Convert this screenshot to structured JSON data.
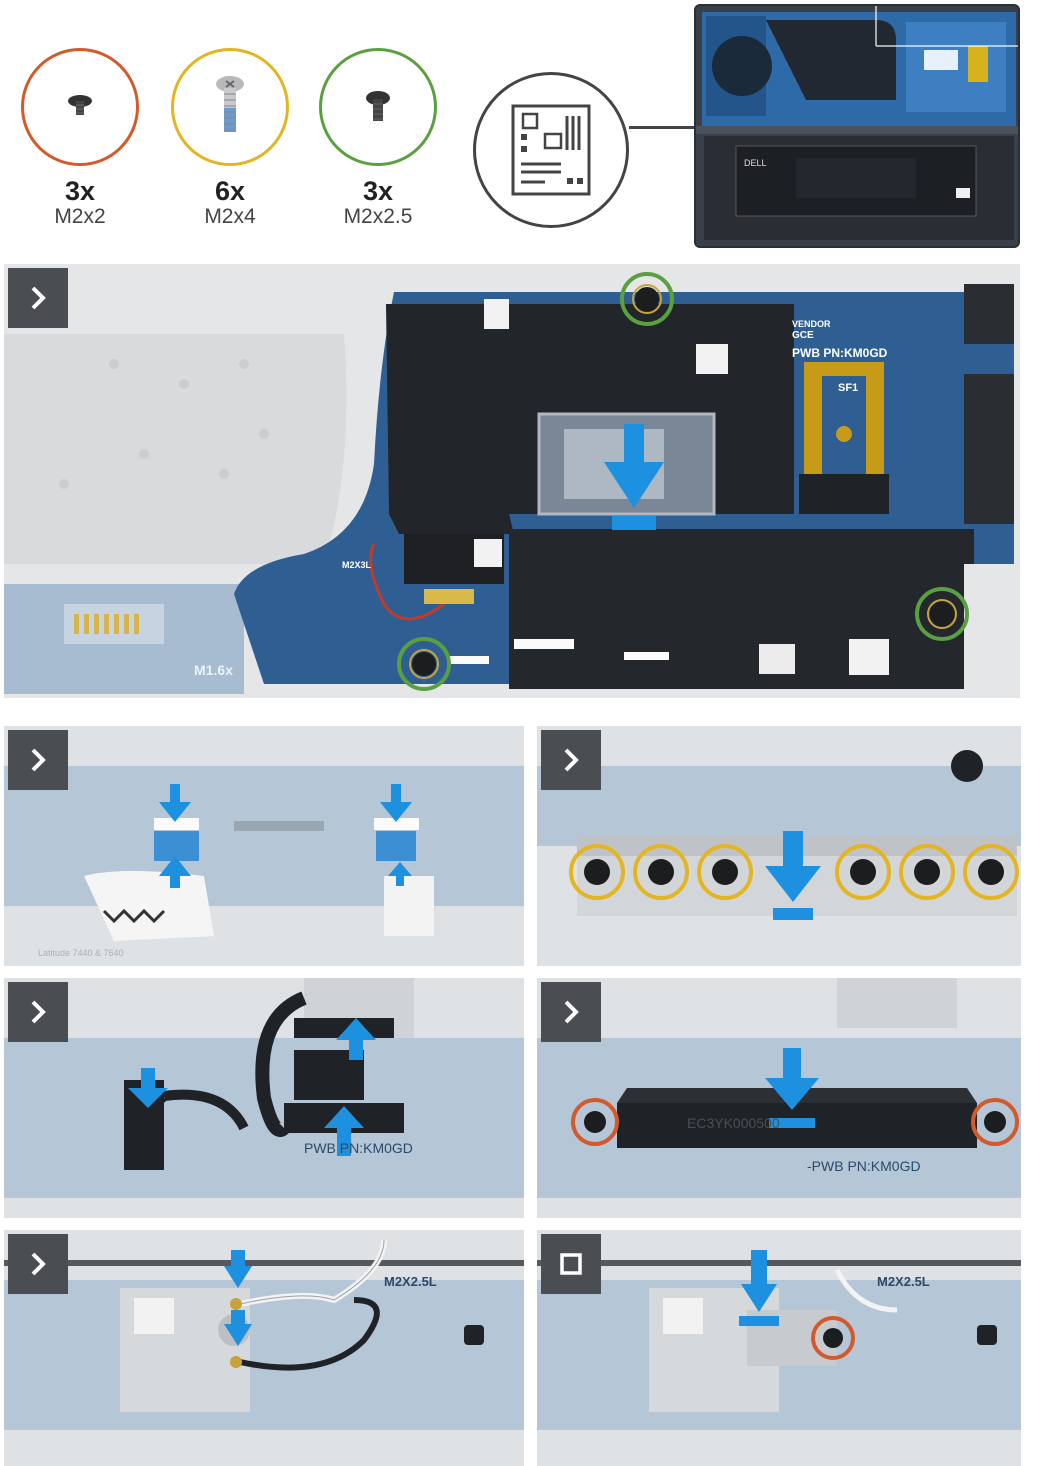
{
  "screws": [
    {
      "qty": "3x",
      "size": "M2x2",
      "ring_color": "#d35a2a"
    },
    {
      "qty": "6x",
      "size": "M2x4",
      "ring_color": "#e3b520"
    },
    {
      "qty": "3x",
      "size": "M2x2.5",
      "ring_color": "#5aa040"
    }
  ],
  "colors": {
    "arrow": "#1e90e0",
    "board": "#2f5f92",
    "step_button": "#4a4d52",
    "panel_bg": "#e6e8ea"
  },
  "main_board": {
    "labels": {
      "m16": "M1.6x",
      "m2x3": "M2X3L",
      "sf1": "SF1",
      "pwb": "PWB PN:KM0GD",
      "vendor": "VENDOR",
      "gce": "GCE"
    }
  },
  "panels": [
    {
      "id": "disconnect-fpc",
      "label_sticker": "Latitude 7440 & 7640"
    },
    {
      "id": "bracket-six-screws"
    },
    {
      "id": "display-cable",
      "board_text": "PWB PN:KM0GD"
    },
    {
      "id": "bracket-two-screws",
      "board_text": "-PWB PN:KM0GD",
      "bracket_text": "EC3YK000500"
    },
    {
      "id": "wlan-antennas",
      "board_text": "M2X2.5L"
    },
    {
      "id": "wlan-bracket",
      "board_text": "M2X2.5L"
    }
  ],
  "icons": {
    "step_next": "chevron-right-icon",
    "step_final": "square-stop-icon",
    "motherboard": "motherboard-icon"
  }
}
